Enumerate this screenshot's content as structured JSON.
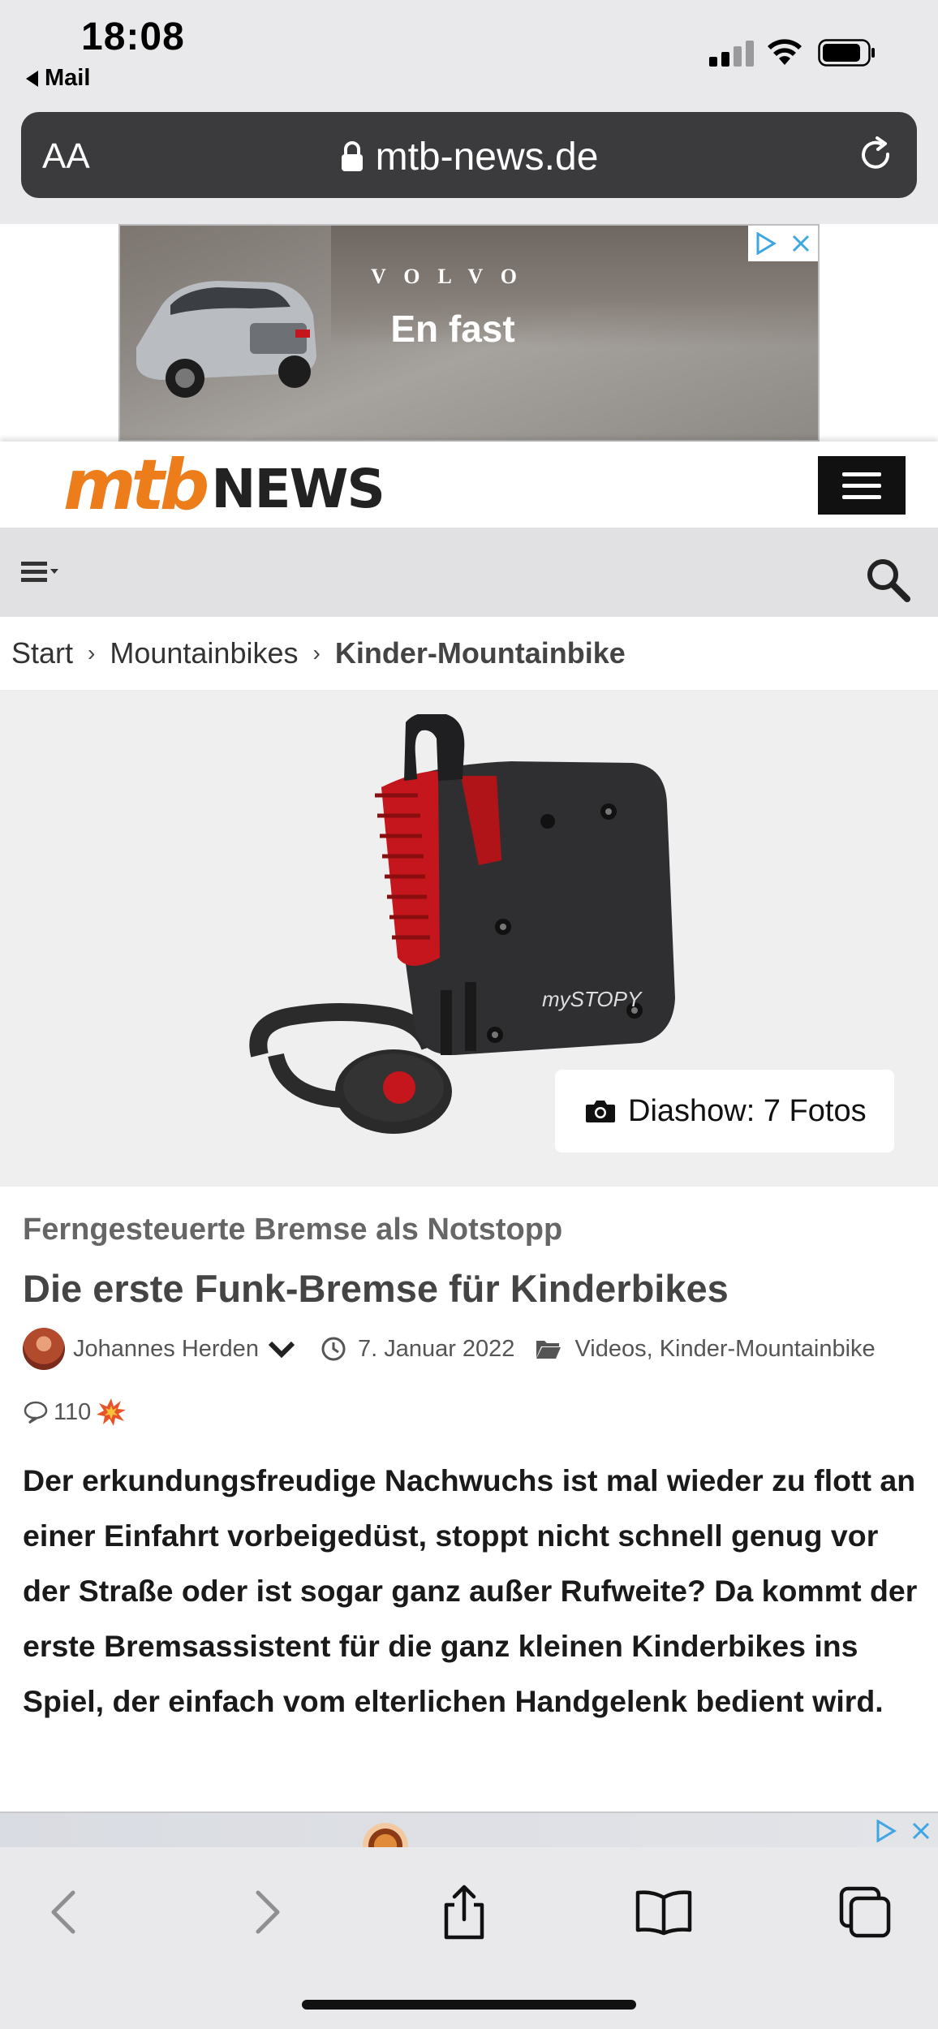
{
  "status_bar": {
    "time": "18:08",
    "back_label": "Mail"
  },
  "browser": {
    "text_size_label": "AA",
    "url_host": "mtb-news.de"
  },
  "ad": {
    "brand": "VOLVO",
    "slogan": "En fast"
  },
  "site": {
    "logo_part1": "mtb",
    "logo_part2": "NEWS"
  },
  "breadcrumb": {
    "items": [
      "Start",
      "Mountainbikes",
      "Kinder-Mountainbike"
    ],
    "separator": "›"
  },
  "hero": {
    "product_brand": "mySTOPY",
    "slideshow_label": "Diashow: 7 Fotos"
  },
  "article": {
    "kicker": "Ferngesteuerte Bremse als Notstopp",
    "headline": "Die erste Funk-Bremse für Kinderbikes",
    "author": "Johannes Herden",
    "date": "7. Januar 2022",
    "categories": "Videos, Kinder-Mountainbike",
    "comment_count": "110",
    "lead": "Der erkundungsfreudige Nachwuchs ist mal wieder zu flott an einer Einfahrt vorbeigedüst, stoppt nicht schnell genug vor der Straße oder ist sogar ganz außer Rufweite? Da kommt der erste Bremsassistent für die ganz kleinen Kinderbikes ins Spiel, der einfach vom elterlichen Handgelenk bedient wird."
  },
  "colors": {
    "brand_orange": "#ed7d1a",
    "adchoices_blue": "#3ea6e0",
    "product_red": "#c4161c"
  },
  "icons": {
    "signal": "cellular-signal-icon",
    "wifi": "wifi-icon",
    "battery": "battery-icon",
    "lock": "lock-icon",
    "reload": "reload-icon",
    "menu": "hamburger-menu-icon",
    "list": "list-menu-icon",
    "search": "search-icon",
    "camera": "camera-icon",
    "clock": "clock-icon",
    "folder": "folder-icon",
    "comment": "comment-icon",
    "hot": "explosion-icon",
    "back": "back-arrow-icon",
    "forward": "forward-arrow-icon",
    "share": "share-icon",
    "bookmarks": "bookmarks-icon",
    "tabs": "tabs-icon"
  }
}
